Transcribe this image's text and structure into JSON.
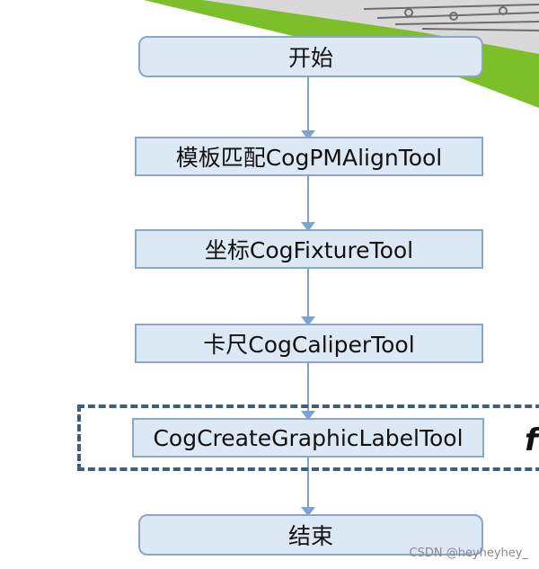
{
  "flowchart": {
    "start": "开始",
    "steps": [
      "模板匹配CogPMAlignTool",
      "坐标CogFixtureTool",
      "卡尺CogCaliperTool",
      "CogCreateGraphicLabelTool"
    ],
    "end": "结束"
  },
  "partial_text": "fl",
  "watermark": "CSDN @heyheyhey_",
  "colors": {
    "node_fill": "#dde8f5",
    "node_border": "#8aa6c8",
    "arrow": "#7fa3cc",
    "dashed_frame": "#3f5e7d",
    "accent_green": "#7cbf2a"
  }
}
